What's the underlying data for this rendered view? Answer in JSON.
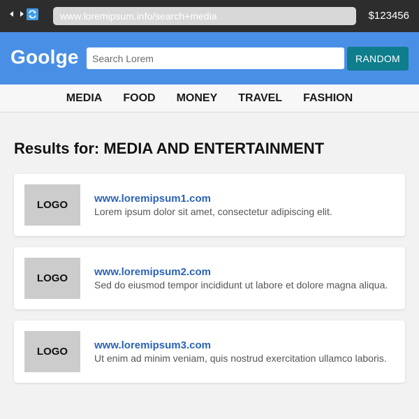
{
  "browser": {
    "url": "www.loremipsum.info/search+media",
    "balance": "$123456"
  },
  "header": {
    "brand": "Goolge",
    "search_placeholder": "Search Lorem",
    "random_label": "RANDOM"
  },
  "categories": [
    "MEDIA",
    "FOOD",
    "MONEY",
    "TRAVEL",
    "FASHION"
  ],
  "results": {
    "title": "Results for: MEDIA AND ENTERTAINMENT",
    "items": [
      {
        "logo": "LOGO",
        "url": "www.loremipsum1.com",
        "description": "Lorem ipsum dolor sit amet, consectetur adipiscing elit."
      },
      {
        "logo": "LOGO",
        "url": "www.loremipsum2.com",
        "description": "Sed do eiusmod tempor incididunt ut labore et dolore magna aliqua."
      },
      {
        "logo": "LOGO",
        "url": "www.loremipsum3.com",
        "description": "Ut enim ad minim veniam, quis nostrud exercitation ullamco laboris."
      }
    ]
  },
  "colors": {
    "header_bg": "#4a8fe6",
    "button_bg": "#0e7d8c",
    "link": "#2a63b8",
    "browser_bar": "#2d2d2d"
  },
  "icons": [
    "back-arrow-icon",
    "forward-arrow-icon",
    "refresh-icon"
  ]
}
